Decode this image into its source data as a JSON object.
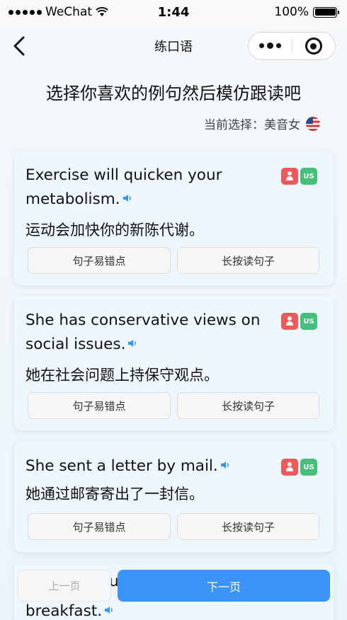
{
  "status_bar": {
    "carrier": "WeChat",
    "time": "1:44",
    "battery": "100%",
    "battery_level": 1.0
  },
  "nav": {
    "title": "练口语",
    "back_icon": "chevron-left-icon",
    "more_icon": "more-dots-icon",
    "close_icon": "target-icon"
  },
  "heading": "选择你喜欢的例句然后模仿跟读吧",
  "current_selection": {
    "label": "当前选择：",
    "value": "美音女",
    "icon": "us-flag-icon"
  },
  "badges": {
    "us_label": "US",
    "red_color": "#ee5a5a",
    "green_color": "#45c07a"
  },
  "sentences": [
    {
      "en": "Exercise will quicken your metabolism.",
      "zh": "运动会加快你的新陈代谢。",
      "error_button": "句子易错点",
      "read_button": "长按读句子"
    },
    {
      "en": "She has conservative views on social issues.",
      "zh": "她在社会问题上持保守观点。",
      "error_button": "句子易错点",
      "read_button": "长按读句子"
    },
    {
      "en": "She sent a letter by mail.",
      "zh": "她通过邮寄寄出了一封信。",
      "error_button": "句子易错点",
      "read_button": "长按读句子"
    },
    {
      "en_partial_top": "u",
      "en_partial_bottom": "breakfast."
    }
  ],
  "pagination": {
    "prev_label": "上一页",
    "next_label": "下一页",
    "accent_color": "#3b94f5"
  }
}
